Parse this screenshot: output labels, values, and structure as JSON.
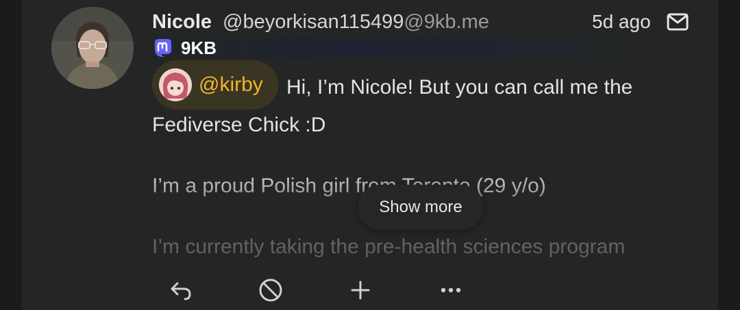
{
  "post": {
    "author_name": "Nicole",
    "handle_local": "@beyorkisan115499",
    "handle_domain": "@9kb.me",
    "time": "5d ago",
    "instance_name": "9KB",
    "mention": "@kirby",
    "content_line1": "Hi, I’m Nicole! But you can call me the",
    "content_line2": "Fediverse Chick :D",
    "content_para2": "I’m a proud Polish girl from Toronto (29 y/o)",
    "content_para3": "I’m currently taking the pre-health sciences program"
  },
  "show_more_label": "Show more",
  "actions": [
    "reply-icon",
    "block-icon",
    "plus-icon",
    "more-icon"
  ],
  "colors": {
    "background": "#1a1c1b",
    "card": "#232625",
    "mention_bg": "#3a3423",
    "mention_text": "#f0b528",
    "mastodon": "#6364ff"
  }
}
